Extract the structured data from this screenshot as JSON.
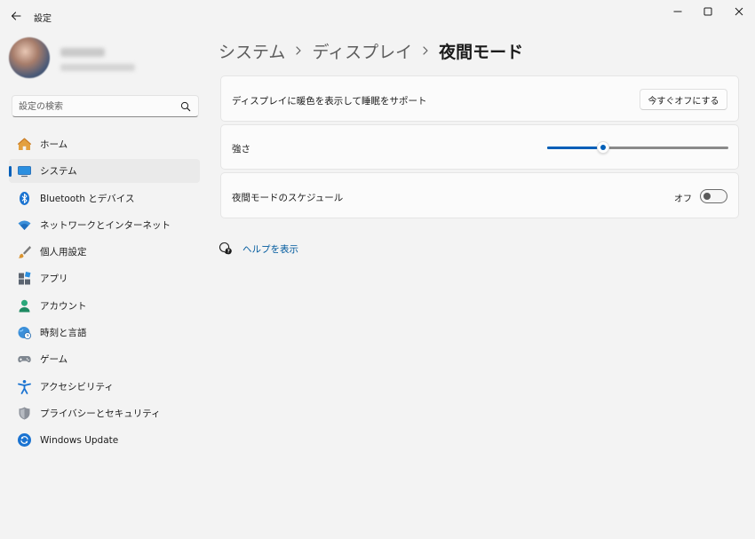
{
  "window": {
    "title": "設定",
    "controls": [
      "minimize-icon",
      "maximize-icon",
      "close-icon"
    ]
  },
  "search": {
    "placeholder": "設定の検索",
    "value": ""
  },
  "sidebar": {
    "items": [
      {
        "label": "ホーム",
        "icon": "home-icon",
        "active": false
      },
      {
        "label": "システム",
        "icon": "system-icon",
        "active": true
      },
      {
        "label": "Bluetooth とデバイス",
        "icon": "bluetooth-icon",
        "active": false
      },
      {
        "label": "ネットワークとインターネット",
        "icon": "wifi-icon",
        "active": false
      },
      {
        "label": "個人用設定",
        "icon": "brush-icon",
        "active": false
      },
      {
        "label": "アプリ",
        "icon": "apps-icon",
        "active": false
      },
      {
        "label": "アカウント",
        "icon": "account-icon",
        "active": false
      },
      {
        "label": "時刻と言語",
        "icon": "time-language-icon",
        "active": false
      },
      {
        "label": "ゲーム",
        "icon": "gamepad-icon",
        "active": false
      },
      {
        "label": "アクセシビリティ",
        "icon": "accessibility-icon",
        "active": false
      },
      {
        "label": "プライバシーとセキュリティ",
        "icon": "shield-icon",
        "active": false
      },
      {
        "label": "Windows Update",
        "icon": "windows-update-icon",
        "active": false
      }
    ]
  },
  "breadcrumb": [
    "システム",
    "ディスプレイ",
    "夜間モード"
  ],
  "settings": {
    "warm_color": {
      "label": "ディスプレイに暖色を表示して睡眠をサポート",
      "button": "今すぐオフにする"
    },
    "strength": {
      "label": "強さ",
      "value_fraction": 0.31
    },
    "schedule": {
      "label": "夜間モードのスケジュール",
      "state": "オフ",
      "on": false
    }
  },
  "help": {
    "label": "ヘルプを表示",
    "icon": "help-chat-icon"
  },
  "colors": {
    "accent": "#005fb8",
    "link": "#005a9e",
    "background": "#f3f3f3",
    "card": "#fbfbfb"
  }
}
